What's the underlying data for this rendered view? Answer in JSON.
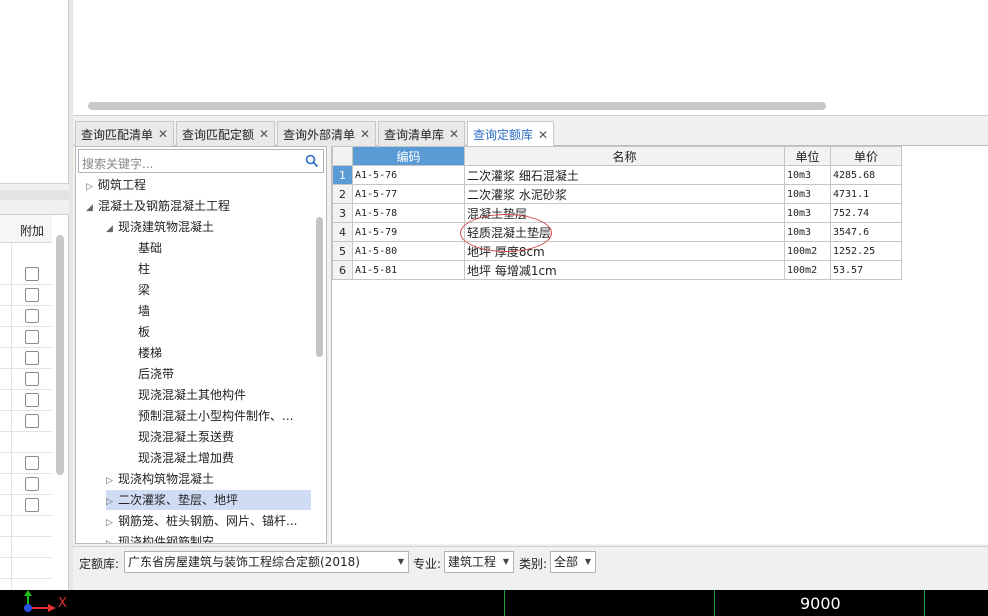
{
  "tabs": [
    {
      "label": "查询匹配清单",
      "close": "✕"
    },
    {
      "label": "查询匹配定额",
      "close": "✕"
    },
    {
      "label": "查询外部清单",
      "close": "✕"
    },
    {
      "label": "查询清单库",
      "close": "✕"
    },
    {
      "label": "查询定额库",
      "close": "✕"
    }
  ],
  "left_grid": {
    "column_header": "附加"
  },
  "search": {
    "placeholder": "搜索关键字..."
  },
  "tree": [
    {
      "label": "砌筑工程",
      "arrow": "▷"
    },
    {
      "label": "混凝土及钢筋混凝土工程",
      "arrow": "◢"
    },
    {
      "label": "现浇建筑物混凝土",
      "arrow": "◢"
    },
    {
      "label": "基础",
      "arrow": ""
    },
    {
      "label": "柱",
      "arrow": ""
    },
    {
      "label": "梁",
      "arrow": ""
    },
    {
      "label": "墙",
      "arrow": ""
    },
    {
      "label": "板",
      "arrow": ""
    },
    {
      "label": "楼梯",
      "arrow": ""
    },
    {
      "label": "后浇带",
      "arrow": ""
    },
    {
      "label": "现浇混凝土其他构件",
      "arrow": ""
    },
    {
      "label": "预制混凝土小型构件制作、...",
      "arrow": ""
    },
    {
      "label": "现浇混凝土泵送费",
      "arrow": ""
    },
    {
      "label": "现浇混凝土增加费",
      "arrow": ""
    },
    {
      "label": "现浇构筑物混凝土",
      "arrow": "▷"
    },
    {
      "label": "二次灌浆、垫层、地坪",
      "arrow": "▷"
    },
    {
      "label": "钢筋笼、桩头钢筋、网片、锚杆...",
      "arrow": "▷"
    },
    {
      "label": "现浇构件钢筋制安",
      "arrow": "▷"
    }
  ],
  "table": {
    "headers": [
      "编码",
      "名称",
      "单位",
      "单价"
    ],
    "rows": [
      {
        "n": "1",
        "code": "A1-5-76",
        "name": "二次灌浆 细石混凝土",
        "unit": "10m3",
        "price": "4285.68"
      },
      {
        "n": "2",
        "code": "A1-5-77",
        "name": "二次灌浆 水泥砂浆",
        "unit": "10m3",
        "price": "4731.1"
      },
      {
        "n": "3",
        "code": "A1-5-78",
        "name": "混凝土垫层",
        "unit": "10m3",
        "price": "752.74"
      },
      {
        "n": "4",
        "code": "A1-5-79",
        "name": "轻质混凝土垫层",
        "unit": "10m3",
        "price": "3547.6"
      },
      {
        "n": "5",
        "code": "A1-5-80",
        "name": "地坪 厚度8cm",
        "unit": "100m2",
        "price": "1252.25"
      },
      {
        "n": "6",
        "code": "A1-5-81",
        "name": "地坪 每增减1cm",
        "unit": "100m2",
        "price": "53.57"
      }
    ]
  },
  "filter": {
    "library_label": "定额库:",
    "library_value": "广东省房屋建筑与装饰工程综合定额(2018)",
    "specialty_label": "专业:",
    "specialty_value": "建筑工程",
    "category_label": "类别:",
    "category_value": "全部",
    "dropdown_glyph": "▼"
  },
  "status": {
    "coordinate": "9000",
    "axis_x_label": "X"
  },
  "colors": {
    "accent": "#5b9bd5",
    "active_tab_text": "#2b6cc4",
    "selection": "#cfdcf3",
    "annotation_circle": "#d24a4a"
  }
}
